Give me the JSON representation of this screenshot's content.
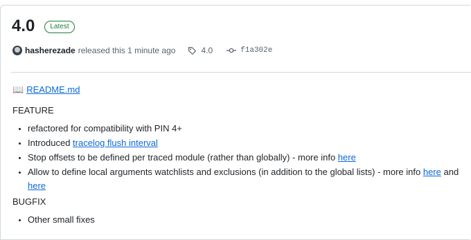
{
  "release": {
    "version": "4.0",
    "badge": "Latest",
    "author": "hasherezade",
    "released_text": "released this 1 minute ago",
    "tag": "4.0",
    "commit": "f1a302e"
  },
  "notes": {
    "readme_icon": "📖",
    "readme_link": "README.md",
    "feature_heading": "FEATURE",
    "features": [
      {
        "text": "refactored for compatibility with PIN 4+"
      },
      {
        "prefix": "Introduced ",
        "link": "tracelog flush interval"
      },
      {
        "prefix": "Stop offsets to be defined per traced module (rather than globally) - more info ",
        "link": "here"
      },
      {
        "prefix": "Allow to define local arguments watchlists and exclusions (in addition to the global lists) - more info ",
        "link": "here",
        "mid": " and ",
        "link2": "here"
      }
    ],
    "bugfix_heading": "BUGFIX",
    "bugfixes": [
      {
        "text": "Other small fixes"
      }
    ]
  },
  "colors": {
    "link": "#0969da",
    "badge": "#1a7f37",
    "border": "#d0d7de",
    "muted": "#59636e"
  }
}
